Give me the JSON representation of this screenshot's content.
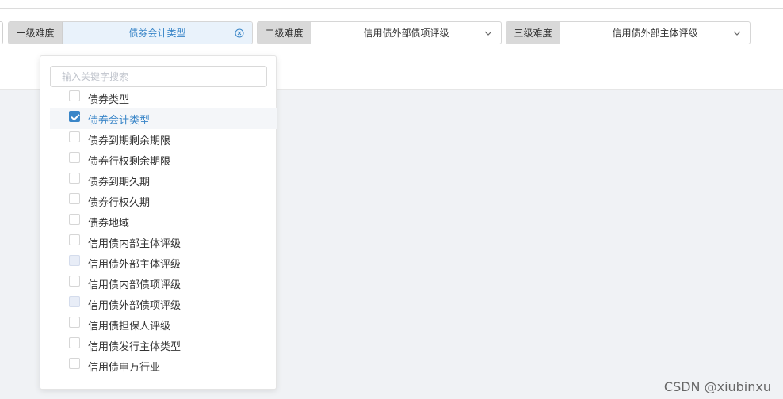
{
  "filters": [
    {
      "label": "一级难度",
      "value": "债券会计类型",
      "icon": "clear-circle-icon"
    },
    {
      "label": "二级难度",
      "value": "信用债外部债项评级",
      "icon": "chevron-down-icon"
    },
    {
      "label": "三级难度",
      "value": "信用债外部主体评级",
      "icon": "chevron-down-icon"
    }
  ],
  "dropdown": {
    "search_placeholder": "输入关键字搜索",
    "options": [
      {
        "label": "债券类型",
        "state": "unchecked"
      },
      {
        "label": "债券会计类型",
        "state": "checked"
      },
      {
        "label": "债券到期剩余期限",
        "state": "unchecked"
      },
      {
        "label": "债券行权剩余期限",
        "state": "unchecked"
      },
      {
        "label": "债券到期久期",
        "state": "unchecked"
      },
      {
        "label": "债券行权久期",
        "state": "unchecked"
      },
      {
        "label": "债券地域",
        "state": "unchecked"
      },
      {
        "label": "信用债内部主体评级",
        "state": "unchecked"
      },
      {
        "label": "信用债外部主体评级",
        "state": "disabled"
      },
      {
        "label": "信用债内部债项评级",
        "state": "unchecked"
      },
      {
        "label": "信用债外部债项评级",
        "state": "disabled"
      },
      {
        "label": "信用债担保人评级",
        "state": "unchecked"
      },
      {
        "label": "信用债发行主体类型",
        "state": "unchecked"
      },
      {
        "label": "信用债申万行业",
        "state": "unchecked"
      }
    ]
  },
  "colors": {
    "accent": "#3a86c8",
    "active_bg": "#e9f2fb",
    "label_bg": "#d9d9d9"
  },
  "watermark": "CSDN @xiubinxu"
}
